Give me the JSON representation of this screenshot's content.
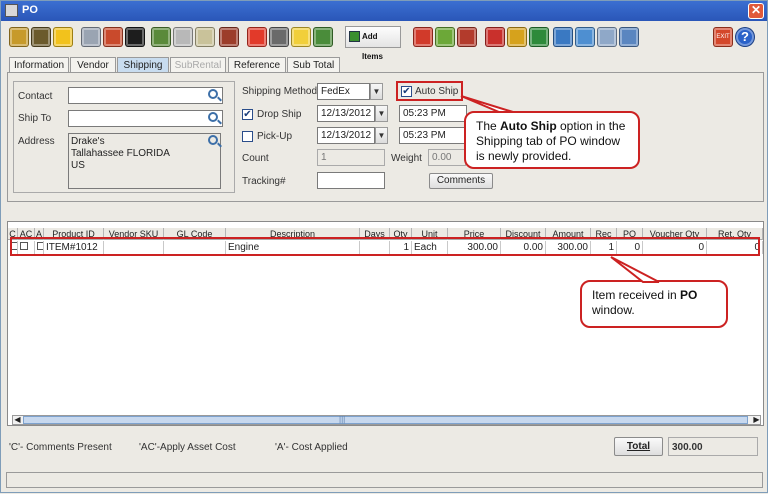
{
  "window": {
    "title": "PO",
    "close_symbol": "✕"
  },
  "toolbar": {
    "buttons": [
      {
        "icon": "save-icon",
        "color": "#c79a2a"
      },
      {
        "icon": "print-icon",
        "color": "#6b5a2c"
      },
      {
        "icon": "disk-icon",
        "color": "#f2c21c"
      },
      {
        "icon": "link-icon",
        "color": "#9aa4b2"
      },
      {
        "icon": "tag-icon",
        "color": "#c94a2c"
      },
      {
        "icon": "sum-icon",
        "color": "#1d1d1d"
      },
      {
        "icon": "grid-add-icon",
        "color": "#5a8a3a"
      },
      {
        "icon": "dome-icon",
        "color": "#b8b8b8"
      },
      {
        "icon": "gear-icon",
        "color": "#c9c29a"
      },
      {
        "icon": "reset-icon",
        "color": "#9c3d2a"
      },
      {
        "icon": "delete-icon",
        "color": "#e23a2a"
      },
      {
        "icon": "coins-icon",
        "color": "#6a6a6a"
      },
      {
        "icon": "edit-icon",
        "color": "#f1cf3a"
      },
      {
        "icon": "transfer-icon",
        "color": "#4a8c3a"
      }
    ],
    "add_items_label": "Add Items",
    "buttons_right": [
      {
        "icon": "box-icon",
        "color": "#d13a2a"
      },
      {
        "icon": "checklist-icon",
        "color": "#6ca838"
      },
      {
        "icon": "truck-icon",
        "color": "#b33b2c"
      },
      {
        "icon": "clipboard-icon",
        "color": "#c9302c"
      },
      {
        "icon": "notes-icon",
        "color": "#d6a21c"
      },
      {
        "icon": "approve-icon",
        "color": "#2d8a3a"
      },
      {
        "icon": "doc-check-icon",
        "color": "#3a79c2"
      },
      {
        "icon": "upload-icon",
        "color": "#4e8fd1"
      },
      {
        "icon": "mail-print-icon",
        "color": "#8fa8c8"
      },
      {
        "icon": "cancel-doc-icon",
        "color": "#5a86c0"
      }
    ],
    "exit_label": "EXIT",
    "help_symbol": "?"
  },
  "tabs": [
    {
      "label": "Information",
      "state": "normal"
    },
    {
      "label": "Vendor",
      "state": "normal"
    },
    {
      "label": "Shipping",
      "state": "active"
    },
    {
      "label": "SubRental",
      "state": "disabled"
    },
    {
      "label": "Reference",
      "state": "normal"
    },
    {
      "label": "Sub Total",
      "state": "normal"
    }
  ],
  "shipping": {
    "contact_label": "Contact",
    "contact_value": "",
    "ship_to_label": "Ship To",
    "ship_to_value": "",
    "address_label": "Address",
    "address_lines": [
      "Drake's",
      "Tallahassee FLORIDA",
      "US"
    ],
    "shipping_method_label": "Shipping Method",
    "shipping_method_value": "FedEx",
    "auto_ship_label": "Auto Ship",
    "auto_ship_checked": true,
    "drop_ship_label": "Drop Ship",
    "drop_ship_checked": true,
    "drop_ship_date": "12/13/2012",
    "drop_ship_time": "05:23 PM",
    "pickup_label": "Pick-Up",
    "pickup_checked": false,
    "pickup_date": "12/13/2012",
    "pickup_time": "05:23 PM",
    "count_label": "Count",
    "count_value": "1",
    "weight_label": "Weight",
    "weight_value": "0.00",
    "tracking_label": "Tracking#",
    "tracking_value": "",
    "comments_label": "Comments",
    "check_mark": "✔",
    "dropdown_arrow": "▼"
  },
  "callouts": {
    "auto_ship_pre": "The ",
    "auto_ship_bold": "Auto Ship",
    "auto_ship_post": " option in the Shipping tab of PO window is newly provided.",
    "item_pre": "Item received in ",
    "item_bold": "PO",
    "item_post": " window."
  },
  "grid": {
    "columns": [
      "C",
      "AC",
      "A",
      "Product ID",
      "Vendor SKU",
      "GL Code",
      "Description",
      "Days",
      "Qty",
      "Unit",
      "Price",
      "Discount",
      "Amount",
      "Rec",
      "PO",
      "Voucher Qty",
      "Ret. Qty"
    ],
    "rows": [
      {
        "product_id": "ITEM#1012",
        "vendor_sku": "",
        "gl_code": "",
        "description": "Engine",
        "days": "",
        "qty": "1",
        "unit": "Each",
        "price": "300.00",
        "discount": "0.00",
        "amount": "300.00",
        "rec": "1",
        "po": "0",
        "voucher_qty": "0",
        "ret_qty": "0"
      }
    ],
    "scroll_grip": "|||",
    "scroll_left": "◀",
    "scroll_right": "▶"
  },
  "footer": {
    "legend_c": "'C'- Comments Present",
    "legend_ac": "'AC'-Apply Asset Cost",
    "legend_a": "'A'- Cost Applied",
    "total_label": "Total",
    "total_value": "300.00"
  }
}
